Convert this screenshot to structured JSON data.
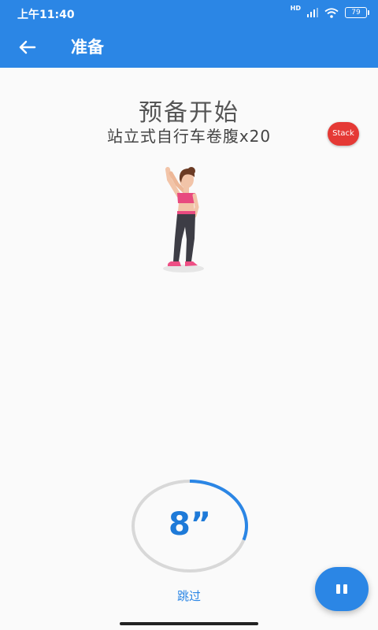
{
  "status_bar": {
    "time": "上午11:40",
    "network": "HD",
    "battery": "79"
  },
  "toolbar": {
    "title": "准备",
    "back_icon": "arrow-left-icon"
  },
  "content": {
    "heading": "预备开始",
    "exercise_name": "站立式自行车卷腹x20",
    "badge": "Stack",
    "figure": "exercise-illustration"
  },
  "timer": {
    "count": "8”",
    "progress": 0.3
  },
  "skip_label": "跳过",
  "pause_button": {
    "icon": "pause-icon"
  },
  "colors": {
    "accent": "#2b86e5",
    "badge": "#e53935",
    "ring_track": "#d8d8d8"
  }
}
